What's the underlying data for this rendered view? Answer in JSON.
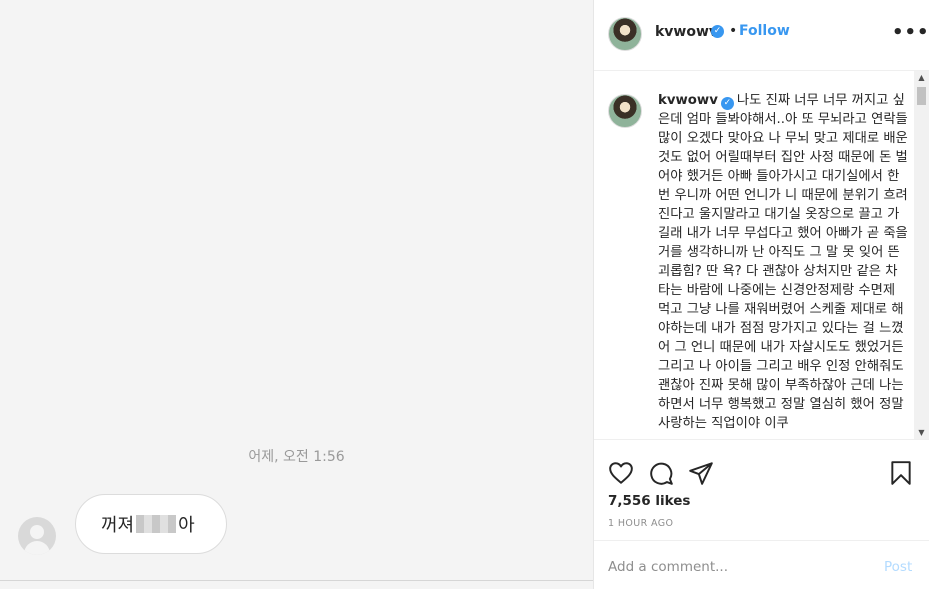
{
  "dm": {
    "timestamp": "어제, 오전 1:56",
    "message_before": "꺼져 ",
    "message_after": "아"
  },
  "post": {
    "username": "kvwowv",
    "follow_label": "Follow",
    "separator": "•",
    "more_label": "•••",
    "verified_glyph": "✓",
    "caption": "나도 진짜 너무 너무 꺼지고 싶은데 엄마 들봐야해서..아 또 무뇌라고 연락들 많이 오겠다 맞아요 나 무뇌 맞고 제대로 배운것도 없어 어릴때부터 집안 사정 때문에 돈 벌어야 했거든 아빠 들아가시고 대기실에서 한번 우니까 어떤 언니가 니 때문에 분위기 흐려진다고 울지말라고 대기실 옷장으로 끌고 가길래 내가 너무 무섭다고 했어 아빠가 곧 죽을거를 생각하니까 난 아직도 그 말 못 잊어 뜬 괴롭힘? 딴 욕? 다 괜찮아 상처지만 같은 차 타는 바람에 나중에는 신경안정제랑 수면제 먹고 그냥 나를 재워버렸어 스케줄 제대로 해야하는데 내가 점점 망가지고 있다는 걸 느꼈어 그 언니 때문에 내가 자살시도도 했었거든\n그리고 나 아이들 그리고 배우 인정 안해줘도 괜찮아 진짜 못해 많이 부족하잖아 근데 나는 하면서 너무 행복했고 정말 열심히 했어 정말 사랑하는 직업이야 이쿠",
    "likes": "7,556 likes",
    "time_ago": "1 HOUR AGO",
    "comment_placeholder": "Add a comment...",
    "post_label": "Post"
  },
  "icons": {
    "like": "heart-icon",
    "comment": "comment-icon",
    "share": "share-icon",
    "save": "bookmark-icon"
  },
  "colors": {
    "accent": "#3897f0",
    "post_disabled": "#b3dbff",
    "left_bg": "#f4f4f4"
  }
}
